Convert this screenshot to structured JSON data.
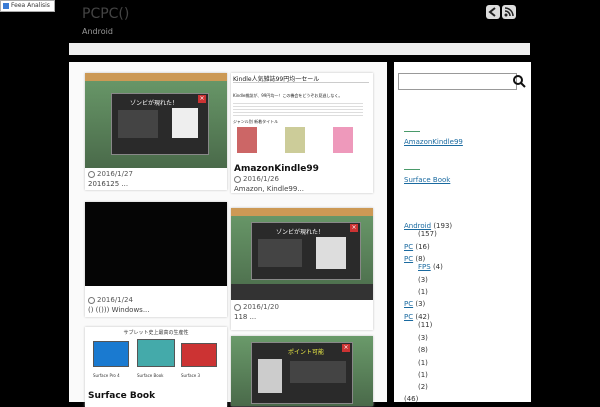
{
  "header": {
    "badge_label": "Feea Analisis",
    "site_title": "PCPC()",
    "tagline": "Android",
    "icons": [
      "back-icon",
      "rss-icon"
    ]
  },
  "posts": [
    {
      "date": "2016/1/27",
      "excerpt": "2016125 ...",
      "thumb_caption": "ゾンビが現れた！"
    },
    {
      "title": "AmazonKindle99",
      "date": "2016/1/26",
      "excerpt": "Amazon, Kindle99...",
      "thumb_heading": "Kindle人気雑誌99円均一セール",
      "thumb_body": "Kindle雑誌が、99円均一！この機会をどうぞお見逃しなく。",
      "thumb_section": "ジャンル別 新着タイトル"
    },
    {
      "date": "2016/1/24",
      "excerpt": "()                    (())) Windows..."
    },
    {
      "date": "2016/1/20",
      "excerpt": "118 ...",
      "thumb_caption": "ゾンビが現れた！"
    },
    {
      "title": "Surface Book",
      "thumb_heading": "サブレット史上最高の生産性",
      "thumb_labels": [
        "Surface Pro 4",
        "Surface Book",
        "Surface 3"
      ]
    },
    {
      "thumb_caption": "ポイント可能"
    }
  ],
  "sidebar": {
    "search_placeholder": "",
    "links": [
      "AmazonKindle99",
      "Surface Book"
    ],
    "categories": [
      {
        "name": "Android",
        "count": "(193)"
      },
      {
        "name": "",
        "count": "(157)"
      },
      {
        "name": "PC",
        "count": "(16)"
      },
      {
        "name": "PC",
        "count": "(8)"
      },
      {
        "name": "FPS",
        "count": "(4)"
      },
      {
        "name": "",
        "count": "(3)"
      },
      {
        "name": "",
        "count": "(1)"
      },
      {
        "name": "PC",
        "count": "(3)"
      },
      {
        "name": "PC",
        "count": "(42)"
      },
      {
        "name": "",
        "count": "(11)"
      },
      {
        "name": "",
        "count": "(3)"
      },
      {
        "name": "",
        "count": "(8)"
      },
      {
        "name": "",
        "count": "(1)"
      },
      {
        "name": "",
        "count": "(1)"
      },
      {
        "name": "",
        "count": "(2)"
      },
      {
        "name": "",
        "count": "(46)"
      }
    ]
  },
  "colors": {
    "link": "#1a6aa0",
    "accent_line": "#4a9a6a",
    "close_red": "#cc3333"
  }
}
